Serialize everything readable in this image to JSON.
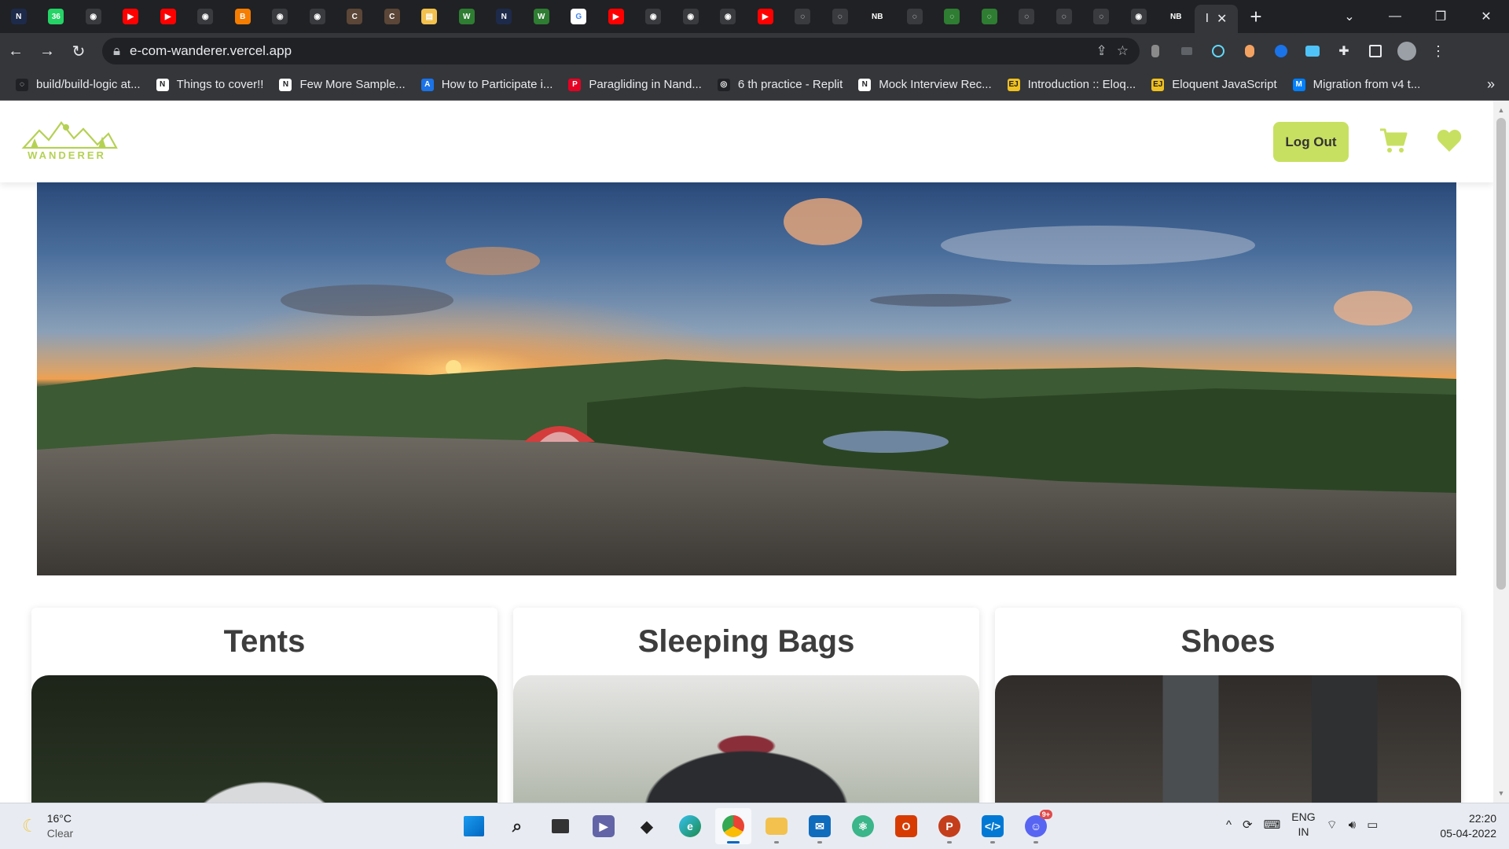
{
  "browser": {
    "tab_favicons": [
      "neog",
      "whatsapp-36",
      "web",
      "youtube",
      "youtube",
      "web",
      "blogger",
      "web",
      "web",
      "codechef",
      "codechef",
      "notes",
      "wordle",
      "neog",
      "wordle",
      "google",
      "youtube",
      "web",
      "web",
      "web",
      "youtube",
      "github",
      "github",
      "notion-nb",
      "github",
      "github-green",
      "github-green",
      "github",
      "github",
      "github",
      "web",
      "notion-nb"
    ],
    "active_tab_label": "I",
    "active_tab_close": "✕",
    "new_tab": "+",
    "url": "e-com-wanderer.vercel.app",
    "bookmarks": [
      {
        "label": "build/build-logic at...",
        "icon": "github"
      },
      {
        "label": "Things to cover!!",
        "icon": "notion"
      },
      {
        "label": "Few More Sample...",
        "icon": "notion"
      },
      {
        "label": "How to Participate i...",
        "icon": "app-store"
      },
      {
        "label": "Paragliding in Nand...",
        "icon": "pinterest"
      },
      {
        "label": "6 th practice - Replit",
        "icon": "replit"
      },
      {
        "label": "Mock Interview Rec...",
        "icon": "notion"
      },
      {
        "label": "Introduction :: Eloq...",
        "icon": "ejs"
      },
      {
        "label": "Eloquent JavaScript",
        "icon": "ejs"
      },
      {
        "label": "Migration from v4 t...",
        "icon": "mui"
      }
    ],
    "bookmarks_more": "»"
  },
  "site": {
    "logo_text": "WANDERER",
    "logout_label": "Log Out",
    "categories": [
      {
        "title": "Tents"
      },
      {
        "title": "Sleeping Bags"
      },
      {
        "title": "Shoes"
      }
    ]
  },
  "taskbar": {
    "weather_temp": "16°C",
    "weather_desc": "Clear",
    "lang_primary": "ENG",
    "lang_secondary": "IN",
    "time": "22:20",
    "date": "05-04-2022",
    "discord_badge": "9+"
  },
  "colors": {
    "brand_green": "#c8e061",
    "browser_dark": "#202124",
    "browser_toolbar": "#35363a"
  }
}
